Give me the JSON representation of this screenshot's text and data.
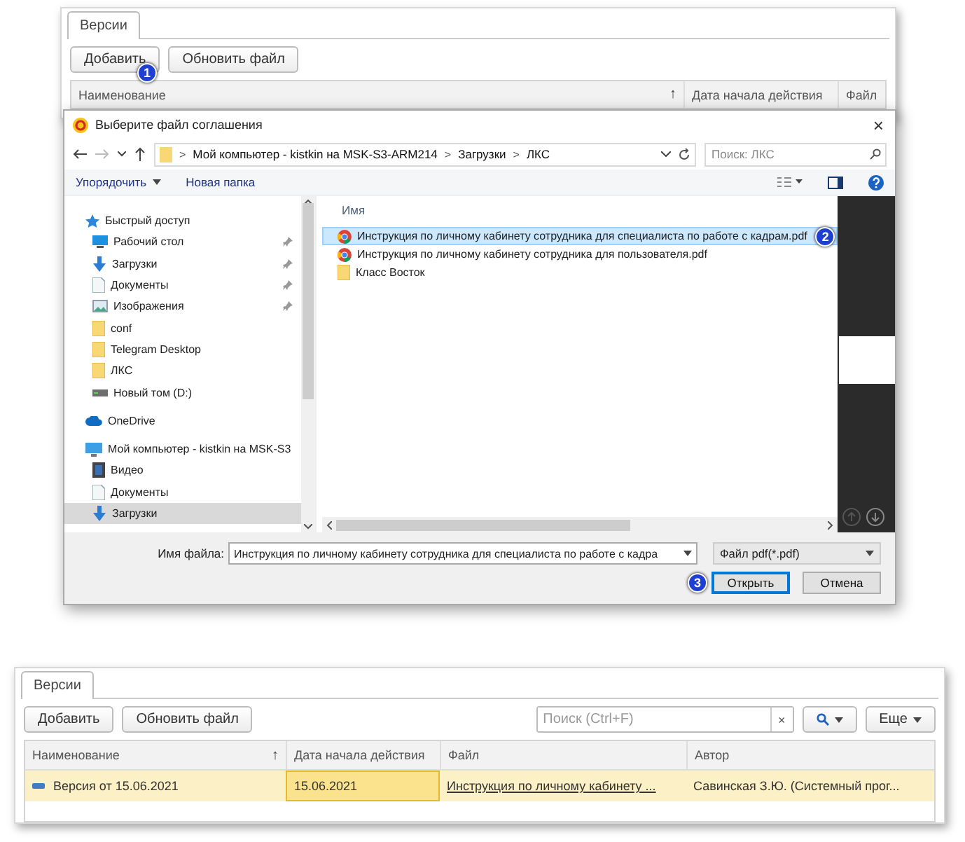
{
  "top_form": {
    "tab": {
      "label": "Версии",
      "selected": true
    },
    "buttons": [
      "Добавить",
      "Обновить файл"
    ],
    "columns": [
      {
        "label": "Наименование",
        "sort": "↑"
      },
      {
        "label": "Дата начала действия"
      },
      {
        "label": "Файл"
      }
    ],
    "step_markers": [
      "1"
    ]
  },
  "dialog": {
    "title": "Выберите файл соглашения",
    "close": "×",
    "address": {
      "segments": [
        "Мой компьютер - kistkin на MSK-S3-ARM214",
        "Загрузки",
        "ЛКС"
      ],
      "separator": ">"
    },
    "search": {
      "placeholder": "Поиск: ЛКС"
    },
    "toolbar": {
      "organize": "Упорядочить",
      "new_folder": "Новая папка"
    },
    "nav": [
      {
        "label": "Быстрый доступ",
        "kind": "star",
        "selected": false,
        "children": [
          {
            "label": "Рабочий стол",
            "kind": "desktop",
            "pinned": true,
            "selected": false
          },
          {
            "label": "Загрузки",
            "kind": "download",
            "pinned": true,
            "selected": false
          },
          {
            "label": "Документы",
            "kind": "document",
            "pinned": true,
            "selected": false
          },
          {
            "label": "Изображения",
            "kind": "image",
            "pinned": true,
            "selected": false
          },
          {
            "label": "conf",
            "kind": "folder",
            "pinned": false,
            "selected": false
          },
          {
            "label": "Telegram Desktop",
            "kind": "folder",
            "pinned": false,
            "selected": false
          },
          {
            "label": "ЛКС",
            "kind": "folder",
            "pinned": false,
            "selected": false
          },
          {
            "label": "Новый том (D:)",
            "kind": "drive",
            "pinned": false,
            "selected": false
          }
        ]
      },
      {
        "label": "OneDrive",
        "kind": "cloud",
        "selected": false
      },
      {
        "label": "Мой компьютер - kistkin на MSK-S3",
        "kind": "computer",
        "selected": false,
        "children": [
          {
            "label": "Видео",
            "kind": "video",
            "selected": false
          },
          {
            "label": "Документы",
            "kind": "document",
            "selected": false
          },
          {
            "label": "Загрузки",
            "kind": "download",
            "selected": true
          }
        ]
      }
    ],
    "list_header": "Имя",
    "files": [
      {
        "name": "Инструкция по личному кабинету сотрудника для специалиста по работе с кадрам.pdf",
        "kind": "pdf",
        "selected": true,
        "marker": "2"
      },
      {
        "name": "Инструкция по личному кабинету сотрудника для пользователя.pdf",
        "kind": "pdf",
        "selected": false
      },
      {
        "name": "Класс Восток",
        "kind": "folder",
        "selected": false
      }
    ],
    "filename": {
      "label": "Имя файла:",
      "value": "Инструкция по личному кабинету сотрудника для специалиста по работе с кадра"
    },
    "filetype": "Файл pdf(*.pdf)",
    "buttons": [
      {
        "label": "Открыть",
        "default": true,
        "marker": "3"
      },
      {
        "label": "Отмена",
        "default": false
      }
    ]
  },
  "bottom_form": {
    "tab": {
      "label": "Версии",
      "selected": true
    },
    "buttons": [
      "Добавить",
      "Обновить файл"
    ],
    "search": {
      "placeholder": "Поиск (Ctrl+F)",
      "clear": "×"
    },
    "more": "Еще",
    "columns": [
      {
        "label": "Наименование",
        "sort": "↑"
      },
      {
        "label": "Дата начала действия"
      },
      {
        "label": "Файл"
      },
      {
        "label": "Автор"
      }
    ],
    "rows": [
      {
        "selected": true,
        "cells": [
          {
            "kind": "name",
            "text": "Версия от 15.06.2021"
          },
          {
            "kind": "date",
            "text": "15.06.2021",
            "selected": true
          },
          {
            "kind": "link",
            "text": "Инструкция по личному кабинету ..."
          },
          {
            "kind": "text",
            "text": "Савинская З.Ю. (Системный прог..."
          }
        ]
      }
    ]
  }
}
